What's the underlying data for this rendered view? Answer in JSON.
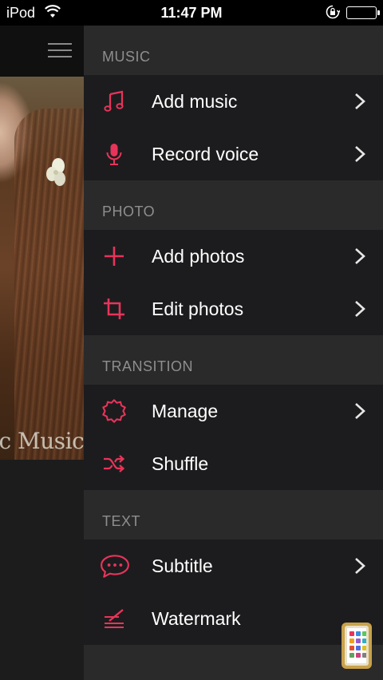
{
  "status_bar": {
    "carrier": "iPod",
    "time": "11:47 PM"
  },
  "left_panel": {
    "photo_overlay_text": "ic Music"
  },
  "menu": {
    "accent_color": "#e8345a",
    "sections": [
      {
        "title": "MUSIC",
        "items": [
          {
            "label": "Add music",
            "icon": "music-note-icon",
            "has_chevron": true
          },
          {
            "label": "Record voice",
            "icon": "microphone-icon",
            "has_chevron": true
          }
        ]
      },
      {
        "title": "PHOTO",
        "items": [
          {
            "label": "Add photos",
            "icon": "plus-icon",
            "has_chevron": true
          },
          {
            "label": "Edit photos",
            "icon": "crop-icon",
            "has_chevron": true
          }
        ]
      },
      {
        "title": "TRANSITION",
        "items": [
          {
            "label": "Manage",
            "icon": "gear-icon",
            "has_chevron": true
          },
          {
            "label": "Shuffle",
            "icon": "shuffle-icon",
            "has_chevron": false
          }
        ]
      },
      {
        "title": "TEXT",
        "items": [
          {
            "label": "Subtitle",
            "icon": "speech-bubble-icon",
            "has_chevron": true
          },
          {
            "label": "Watermark",
            "icon": "watermark-pen-icon",
            "has_chevron": false
          }
        ]
      }
    ]
  }
}
